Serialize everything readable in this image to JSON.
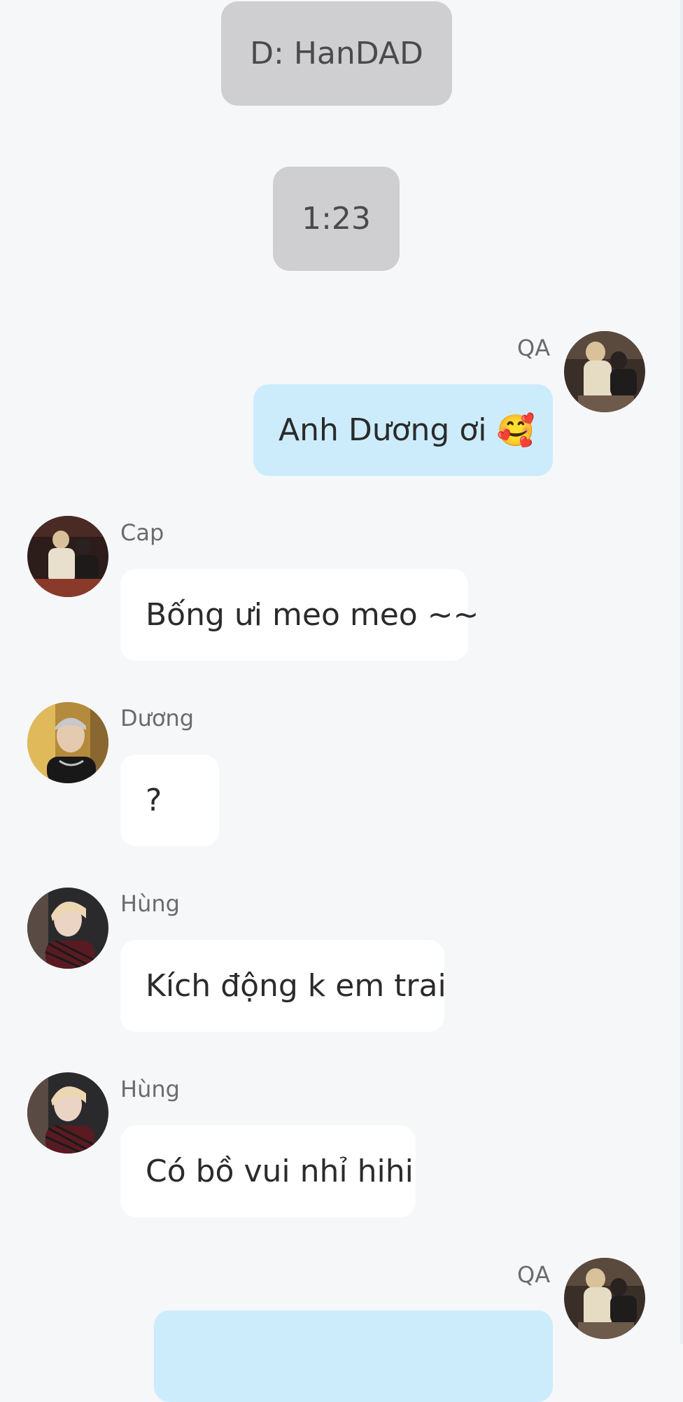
{
  "system_messages": [
    {
      "text": "D: HanDAD"
    },
    {
      "text": "1:23"
    }
  ],
  "messages": [
    {
      "sender": "QA",
      "side": "outgoing",
      "text": "Anh Dương ơi",
      "emoji": "🥰",
      "avatar_icon": "couple-photo-avatar"
    },
    {
      "sender": "Cap",
      "side": "incoming",
      "text": "Bống ưi meo meo ~~",
      "avatar_icon": "couple-photo-avatar"
    },
    {
      "sender": "Dương",
      "side": "incoming",
      "text": "?",
      "avatar_icon": "portrait-avatar"
    },
    {
      "sender": "Hùng",
      "side": "incoming",
      "text": "Kích động k em trai",
      "avatar_icon": "blonde-portrait-avatar"
    },
    {
      "sender": "Hùng",
      "side": "incoming",
      "text": "Có bồ vui nhỉ hihi",
      "avatar_icon": "blonde-portrait-avatar"
    },
    {
      "sender": "QA",
      "side": "outgoing",
      "text": "",
      "avatar_icon": "couple-photo-avatar"
    }
  ],
  "colors": {
    "background": "#f6f7f9",
    "system_bubble": "#cfcfd1",
    "incoming_bubble": "#ffffff",
    "outgoing_bubble": "#ccecfb"
  }
}
